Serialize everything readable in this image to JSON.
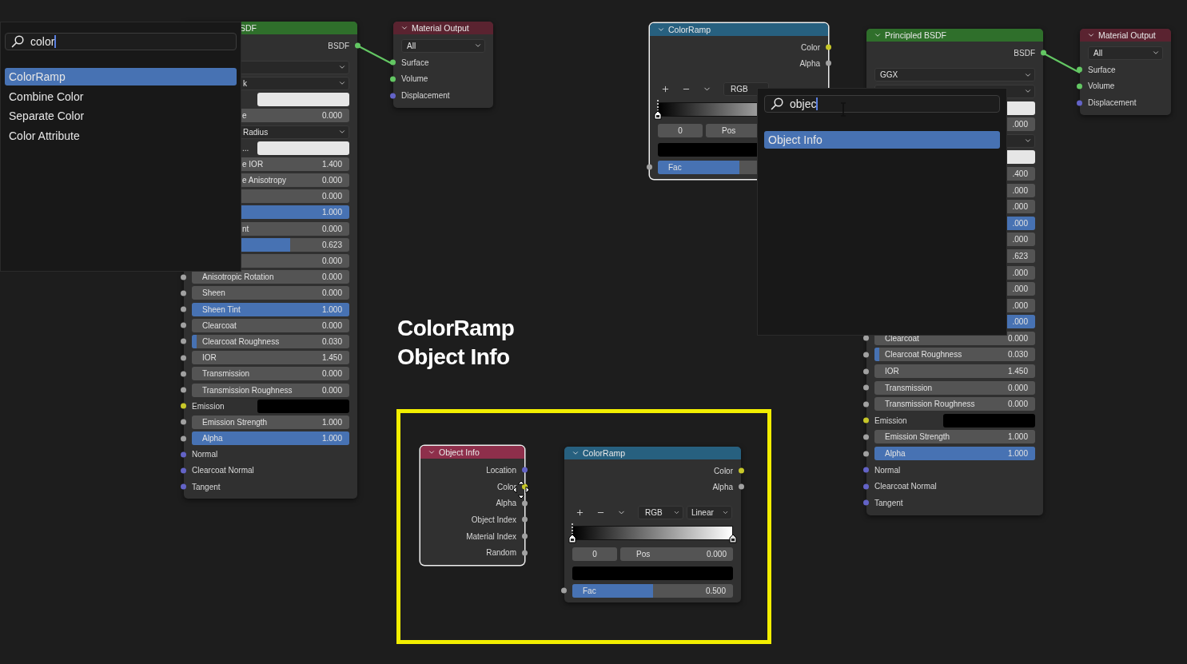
{
  "search_popups": [
    {
      "query": "color",
      "results": [
        {
          "label": "ColorRamp",
          "selected": true
        },
        {
          "label": "Combine Color",
          "selected": false
        },
        {
          "label": "Separate Color",
          "selected": false
        },
        {
          "label": "Color Attribute",
          "selected": false
        }
      ]
    },
    {
      "query": "objec",
      "results": [
        {
          "label": "Object Info",
          "selected": true
        }
      ]
    }
  ],
  "nodes": [
    {
      "title": "SDF",
      "color": "#2f6f2b",
      "selected": false,
      "header_covered": true,
      "rows": [
        {
          "kind": "output",
          "label": "BSDF",
          "color": "#63c763"
        },
        {
          "kind": "dropdown",
          "covered": true
        },
        {
          "kind": "dropdown",
          "value": "k",
          "covered": true
        },
        {
          "kind": "swatch",
          "swatch": {
            "color": "#e6e6e6"
          },
          "covered": true
        },
        {
          "kind": "slider",
          "label": "e",
          "value": "0.000",
          "covered": true
        },
        {
          "kind": "dropdown",
          "value": "Radius",
          "covered": true
        },
        {
          "kind": "swatch",
          "label": "...",
          "swatch": {
            "color": "#e6e6e6"
          },
          "covered": true
        },
        {
          "kind": "slider",
          "label": "e IOR",
          "value": "1.400",
          "covered": true
        },
        {
          "kind": "slider",
          "label": "e Anisotropy",
          "value": "0.000",
          "covered": true
        },
        {
          "kind": "slider",
          "value": "0.000",
          "covered": true
        },
        {
          "kind": "slider",
          "value": "1.000",
          "level": 1,
          "covered": true
        },
        {
          "kind": "slider",
          "label": "nt",
          "value": "0.000",
          "covered": true
        },
        {
          "kind": "slider",
          "value": "0.623",
          "level": 0.623,
          "covered": true
        },
        {
          "kind": "slider",
          "value": "0.000",
          "covered": true
        },
        {
          "kind": "slider",
          "label": "Anisotropic Rotation",
          "value": "0.000",
          "color": "#a1a1a1"
        },
        {
          "kind": "slider",
          "label": "Sheen",
          "value": "0.000",
          "color": "#a1a1a1"
        },
        {
          "kind": "slider",
          "label": "Sheen Tint",
          "value": "1.000",
          "level": 1,
          "color": "#a1a1a1"
        },
        {
          "kind": "slider",
          "label": "Clearcoat",
          "value": "0.000",
          "color": "#a1a1a1"
        },
        {
          "kind": "slider",
          "label": "Clearcoat Roughness",
          "value": "0.030",
          "level": 0.03,
          "color": "#a1a1a1"
        },
        {
          "kind": "slider",
          "label": "IOR",
          "value": "1.450",
          "color": "#a1a1a1"
        },
        {
          "kind": "slider",
          "label": "Transmission",
          "value": "0.000",
          "color": "#a1a1a1"
        },
        {
          "kind": "slider",
          "label": "Transmission Roughness",
          "value": "0.000",
          "color": "#a1a1a1"
        },
        {
          "kind": "swatch",
          "label": "Emission",
          "swatch": {
            "color": "#000000"
          },
          "color": "#c7c729"
        },
        {
          "kind": "slider",
          "label": "Emission Strength",
          "value": "1.000",
          "color": "#a1a1a1"
        },
        {
          "kind": "slider",
          "label": "Alpha",
          "value": "1.000",
          "level": 1,
          "color": "#a1a1a1"
        },
        {
          "kind": "input",
          "label": "Normal",
          "color": "#6363c7"
        },
        {
          "kind": "input",
          "label": "Clearcoat Normal",
          "color": "#6363c7"
        },
        {
          "kind": "input",
          "label": "Tangent",
          "color": "#6363c7"
        }
      ]
    },
    {
      "title": "Material Output",
      "color": "#5a2330",
      "selected": false,
      "rows": [
        {
          "kind": "dropdown",
          "value": "All"
        },
        {
          "kind": "input",
          "label": "Surface",
          "color": "#63c763"
        },
        {
          "kind": "input",
          "label": "Volume",
          "color": "#63c763"
        },
        {
          "kind": "input",
          "label": "Displacement",
          "color": "#6363c7"
        }
      ]
    },
    {
      "title": "ColorRamp",
      "color": "#27607f",
      "selected": true,
      "rows": [
        {
          "kind": "output",
          "label": "Color",
          "color": "#c7c729"
        },
        {
          "kind": "output",
          "label": "Alpha",
          "color": "#a1a1a1"
        },
        {
          "kind": "ramp_toolbar",
          "mode": "RGB"
        },
        {
          "kind": "ramp_gradient",
          "stops": [
            {
              "selected": true
            }
          ]
        },
        {
          "kind": "ramp_fields",
          "index": "0",
          "pos_label": "Pos"
        },
        {
          "kind": "swatch",
          "swatch": {
            "color": "#000000"
          }
        },
        {
          "kind": "slider",
          "label": "Fac",
          "level": 0.5,
          "color": "#a1a1a1"
        }
      ]
    },
    {
      "title": "Principled BSDF",
      "color": "#2f6f2b",
      "selected": false,
      "rows": [
        {
          "kind": "output",
          "label": "BSDF",
          "color": "#63c763"
        },
        {
          "kind": "dropdown",
          "value": "GGX"
        },
        {
          "kind": "dropdown",
          "covered": true
        },
        {
          "kind": "swatch",
          "swatch": {
            "color": "#e6e6e6"
          },
          "covered": true
        },
        {
          "kind": "slider",
          "value": ".000",
          "covered": true
        },
        {
          "kind": "dropdown",
          "covered": true
        },
        {
          "kind": "swatch",
          "swatch": {
            "color": "#e6e6e6"
          },
          "covered": true
        },
        {
          "kind": "slider",
          "value": ".400",
          "covered": true
        },
        {
          "kind": "slider",
          "value": ".000",
          "covered": true
        },
        {
          "kind": "slider",
          "value": ".000",
          "covered": true
        },
        {
          "kind": "slider",
          "value": ".000",
          "level": 1,
          "covered": true
        },
        {
          "kind": "slider",
          "value": ".000",
          "covered": true
        },
        {
          "kind": "slider",
          "value": ".623",
          "covered": true
        },
        {
          "kind": "slider",
          "value": ".000",
          "covered": true
        },
        {
          "kind": "slider",
          "value": ".000",
          "covered": true
        },
        {
          "kind": "slider",
          "value": ".000",
          "covered": true
        },
        {
          "kind": "slider",
          "value": ".000",
          "level": 1,
          "covered": true
        },
        {
          "kind": "slider",
          "label": "Clearcoat",
          "value": "0.000",
          "color": "#a1a1a1"
        },
        {
          "kind": "slider",
          "label": "Clearcoat Roughness",
          "value": "0.030",
          "level": 0.03,
          "color": "#a1a1a1"
        },
        {
          "kind": "slider",
          "label": "IOR",
          "value": "1.450",
          "color": "#a1a1a1"
        },
        {
          "kind": "slider",
          "label": "Transmission",
          "value": "0.000",
          "color": "#a1a1a1"
        },
        {
          "kind": "slider",
          "label": "Transmission Roughness",
          "value": "0.000",
          "color": "#a1a1a1"
        },
        {
          "kind": "swatch",
          "label": "Emission",
          "swatch": {
            "color": "#000000"
          },
          "color": "#c7c729"
        },
        {
          "kind": "slider",
          "label": "Emission Strength",
          "value": "1.000",
          "color": "#a1a1a1"
        },
        {
          "kind": "slider",
          "label": "Alpha",
          "value": "1.000",
          "level": 1,
          "color": "#a1a1a1"
        },
        {
          "kind": "input",
          "label": "Normal",
          "color": "#6363c7"
        },
        {
          "kind": "input",
          "label": "Clearcoat Normal",
          "color": "#6363c7"
        },
        {
          "kind": "input",
          "label": "Tangent",
          "color": "#6363c7"
        }
      ]
    },
    {
      "title": "Material Output",
      "color": "#5a2330",
      "selected": false,
      "rows": [
        {
          "kind": "dropdown",
          "value": "All"
        },
        {
          "kind": "input",
          "label": "Surface",
          "color": "#63c763"
        },
        {
          "kind": "input",
          "label": "Volume",
          "color": "#63c763"
        },
        {
          "kind": "input",
          "label": "Displacement",
          "color": "#6363c7"
        }
      ]
    },
    {
      "title": "Object Info",
      "color": "#8e2f4b",
      "selected": true,
      "rows": [
        {
          "kind": "output",
          "label": "Location",
          "color": "#6363c7"
        },
        {
          "kind": "output",
          "label": "Color",
          "color": "#c7c729"
        },
        {
          "kind": "output",
          "label": "Alpha",
          "color": "#a1a1a1"
        },
        {
          "kind": "output",
          "label": "Object Index",
          "color": "#a1a1a1"
        },
        {
          "kind": "output",
          "label": "Material Index",
          "color": "#a1a1a1"
        },
        {
          "kind": "output",
          "label": "Random",
          "color": "#a1a1a1"
        }
      ]
    },
    {
      "title": "ColorRamp",
      "color": "#27607f",
      "selected": false,
      "rows": [
        {
          "kind": "output",
          "label": "Color",
          "color": "#c7c729"
        },
        {
          "kind": "output",
          "label": "Alpha",
          "color": "#a1a1a1"
        },
        {
          "kind": "ramp_toolbar",
          "mode": "RGB",
          "interpolation": "Linear"
        },
        {
          "kind": "ramp_gradient",
          "stops": [
            {
              "selected": true
            },
            {
              "selected": false
            }
          ]
        },
        {
          "kind": "ramp_fields",
          "index": "0",
          "pos_label": "Pos",
          "pos_value": "0.000"
        },
        {
          "kind": "swatch",
          "swatch": {
            "color": "#000000"
          }
        },
        {
          "kind": "slider",
          "label": "Fac",
          "value": "0.500",
          "level": 0.5,
          "color": "#a1a1a1"
        }
      ]
    }
  ],
  "caption_lines": [
    "ColorRamp",
    "Object Info"
  ]
}
